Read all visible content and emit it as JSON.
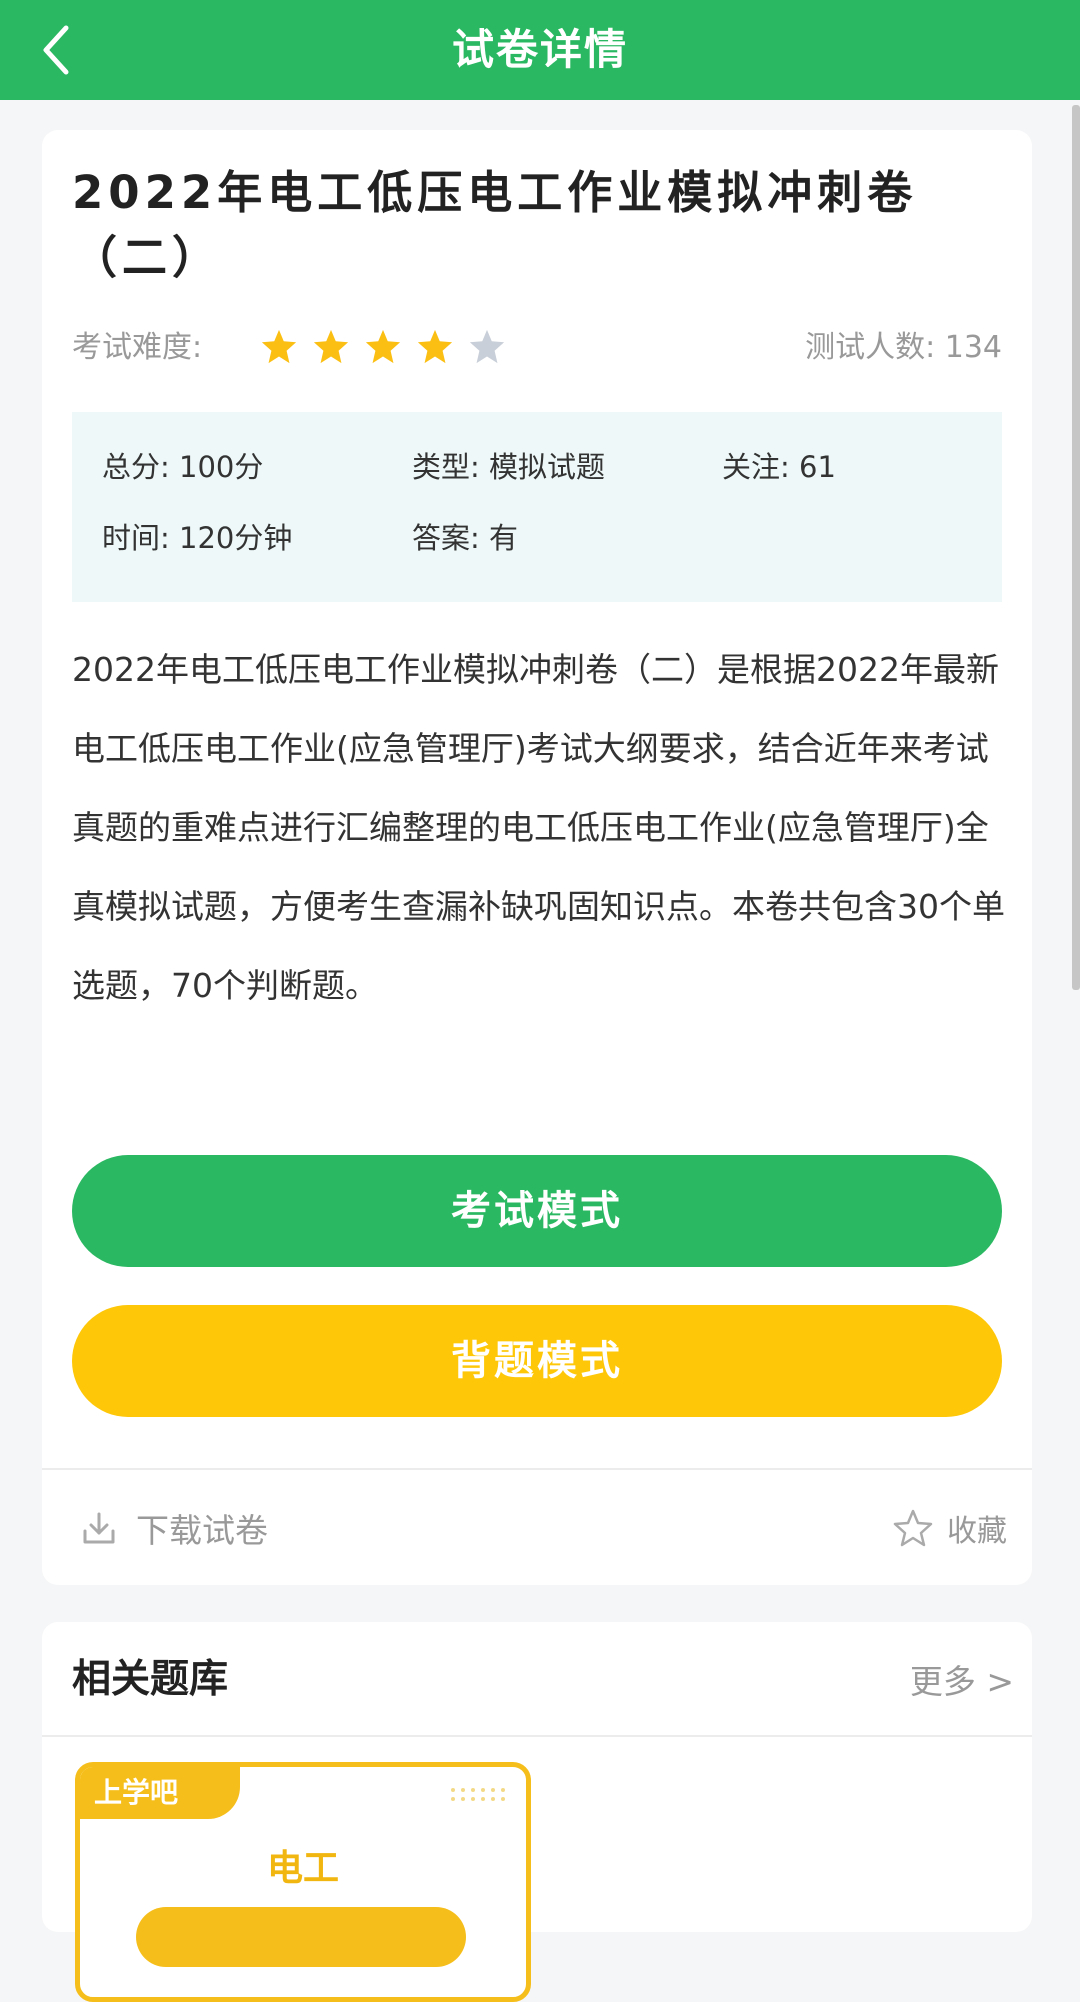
{
  "header": {
    "title": "试卷详情"
  },
  "paper": {
    "title": "2022年电工低压电工作业模拟冲刺卷（二）",
    "difficulty_label": "考试难度:",
    "difficulty_rating": 4,
    "difficulty_max": 5,
    "testers_label": "测试人数: ",
    "testers_count": "134",
    "info": {
      "total": "总分: 100分",
      "type": "类型: 模拟试题",
      "follow": "关注: 61",
      "time": "时间: 120分钟",
      "answer": "答案: 有"
    },
    "description": "2022年电工低压电工作业模拟冲刺卷（二）是根据2022年最新电工低压电工作业(应急管理厅)考试大纲要求，结合近年来考试真题的重难点进行汇编整理的电工低压电工作业(应急管理厅)全真模拟试题，方便考生查漏补缺巩固知识点。本卷共包含30个单选题，70个判断题。"
  },
  "buttons": {
    "exam_mode": "考试模式",
    "recite_mode": "背题模式",
    "download": "下载试卷",
    "favorite": "收藏"
  },
  "related": {
    "title": "相关题库",
    "more": "更多 >",
    "items": [
      {
        "brand": "上学吧",
        "name": "电工"
      }
    ]
  },
  "colors": {
    "primary_green": "#2bb862",
    "accent_yellow": "#fec708",
    "star_on": "#fbbf13",
    "star_off": "#c9cfd8"
  }
}
